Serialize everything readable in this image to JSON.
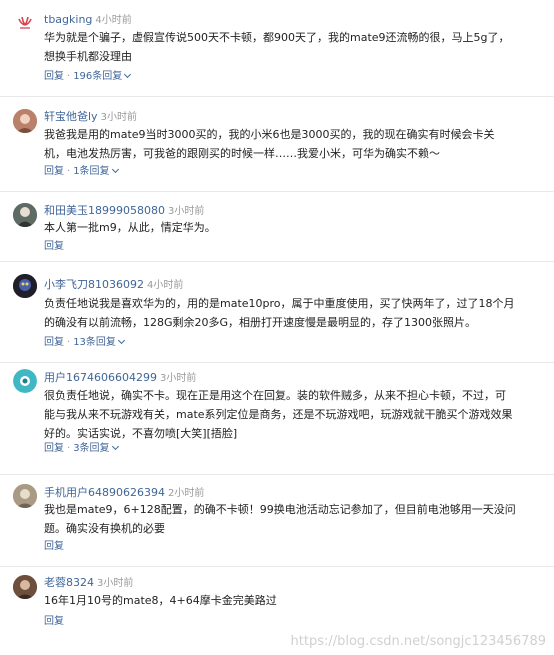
{
  "comments": [
    {
      "user": "tbagking",
      "time": "4小时前",
      "text": "华为就是个骗子，虚假宣传说500天不卡顿，都900天了，我的mate9还流畅的很，马上5g了，想换手机都没理由",
      "reply": "回复",
      "replies": "196条回复"
    },
    {
      "user": "轩宝他爸ly",
      "time": "3小时前",
      "text": "我爸我是用的mate9当时3000买的，我的小米6也是3000买的，我的现在确实有时候会卡关机，电池发热厉害，可我爸的跟刚买的时候一样……我爱小米，可华为确实不赖～",
      "reply": "回复",
      "replies": "1条回复"
    },
    {
      "user": "和田美玉18999058080",
      "time": "3小时前",
      "text": "本人第一批m9，从此，情定华为。",
      "reply": "回复",
      "replies": ""
    },
    {
      "user": "小李飞刀81036092",
      "time": "4小时前",
      "text": "负责任地说我是喜欢华为的，用的是mate10pro，属于中重度使用，买了快两年了，过了18个月的确没有以前流畅，128G剩余20多G，相册打开速度慢是最明显的，存了1300张照片。",
      "reply": "回复",
      "replies": "13条回复"
    },
    {
      "user": "用户1674606604299",
      "time": "3小时前",
      "text": "很负责任地说，确实不卡。现在正是用这个在回复。装的软件贼多，从来不担心卡顿，不过，可能与我从来不玩游戏有关，mate系列定位是商务，还是不玩游戏吧，玩游戏就干脆买个游戏效果好的。实话实说，不喜勿喷[大笑][捂脸]",
      "reply": "回复",
      "replies": "3条回复"
    },
    {
      "user": "手机用户64890626394",
      "time": "2小时前",
      "text": "我也是mate9，6+128配置，的确不卡顿！99换电池活动忘记参加了，但目前电池够用一天没问题。确实没有换机的必要",
      "reply": "回复",
      "replies": ""
    },
    {
      "user": "老蓉8324",
      "time": "3小时前",
      "text": "16年1月10号的mate8，4+64摩卡金完美路过",
      "reply": "回复",
      "replies": ""
    }
  ],
  "watermark": "https://blog.csdn.net/songjc123456789",
  "colors": {
    "username": "#406599",
    "time": "#999999",
    "text": "#222222",
    "divider": "#e9e9e9"
  }
}
